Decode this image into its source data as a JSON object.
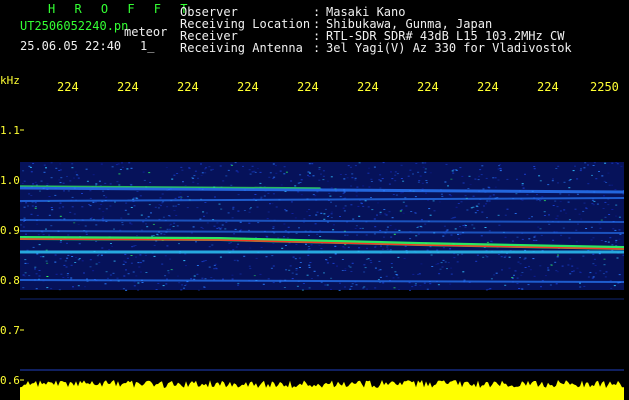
{
  "header": {
    "station": "H R O F F T",
    "filename": "UT2506052240.pn",
    "mode": "meteor",
    "timestamp": "25.06.05 22:40",
    "index": "1_",
    "fields": [
      {
        "label": "Observer",
        "sep": ":",
        "value": "Masaki Kano"
      },
      {
        "label": "Receiving Location",
        "sep": ":",
        "value": "Shibukawa, Gunma, Japan"
      },
      {
        "label": "Receiver",
        "sep": ":",
        "value": "RTL-SDR SDR# 43dB L15 103.2MHz CW"
      },
      {
        "label": "Receiving Antenna",
        "sep": ":",
        "value": "3el Yagi(V) Az 330 for Vladivostok"
      }
    ]
  },
  "axis": {
    "y_unit": "kHz",
    "y_ticks": [
      "1.1",
      "1.0",
      "0.9",
      "0.8",
      "0.7",
      "0.6"
    ],
    "x_ticks": [
      "224",
      "224",
      "224",
      "224",
      "224",
      "224",
      "224",
      "224",
      "224",
      "2250"
    ]
  },
  "colors": {
    "header_green": "#33ff33",
    "label_yellow": "#ffff33",
    "text_white": "#f0f0f0",
    "signal_blue": "#1020c0",
    "signal_green": "#30ff60",
    "signal_red": "#ff3020",
    "amplitude_yellow": "#ffff00"
  }
}
